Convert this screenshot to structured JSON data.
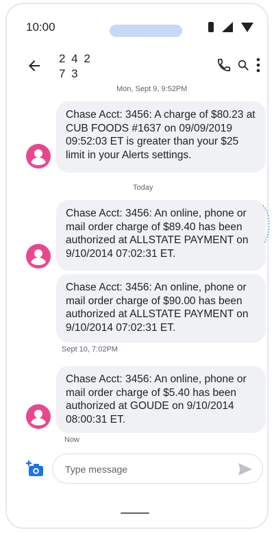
{
  "status_bar": {
    "time": "10:00"
  },
  "header": {
    "contact_line1": "2 4 2",
    "contact_line2": "7 3"
  },
  "timestamps": {
    "t1": "Mon, Sept 9, 9:52PM",
    "t2": "Today",
    "t3": "Sept 10, 7:02PM",
    "t4": "Now"
  },
  "messages": [
    {
      "text": "Chase Acct: 3456: A charge of $80.23 at CUB FOODS #1637 on 09/09/2019 09:52:03 ET is greater than your $25 limit in your Alerts settings."
    },
    {
      "text": "Chase Acct: 3456: An online, phone or mail order charge of $89.40 has been authorized at ALLSTATE PAYMENT on 9/10/2014 07:02:31 ET."
    },
    {
      "text": "Chase Acct: 3456: An online, phone or mail order charge of $90.00 has been authorized at ALLSTATE PAYMENT on 9/10/2014 07:02:31 ET."
    },
    {
      "text": "Chase Acct: 3456: An online, phone or mail order charge of $5.40 has been authorized at GOUDE on 9/10/2014 08:00:31 ET."
    }
  ],
  "composer": {
    "placeholder": "Type message"
  },
  "colors": {
    "avatar": "#e8478e",
    "bubble": "#eff1f4",
    "accent": "#1a73e8",
    "notch": "#c8d9f7"
  },
  "icons": [
    "battery-icon",
    "signal-icon",
    "wifi-icon",
    "back-arrow-icon",
    "phone-icon",
    "search-icon",
    "more-icon",
    "avatar-person-icon",
    "camera-icon",
    "send-icon"
  ]
}
